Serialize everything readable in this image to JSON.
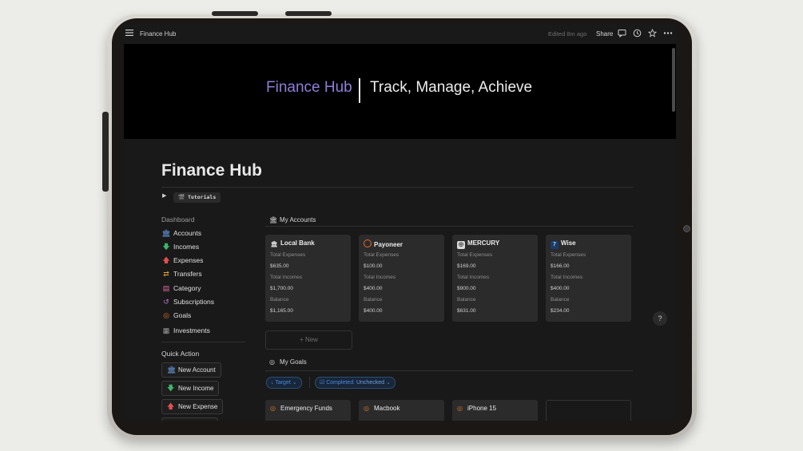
{
  "topbar": {
    "title": "Finance Hub",
    "edited": "Edited 8m ago",
    "share": "Share"
  },
  "cover": {
    "brand": "Finance Hub",
    "tagline": "Track, Manage, Achieve"
  },
  "page": {
    "title": "Finance Hub",
    "tutorials": "Tutorials"
  },
  "sidebar": {
    "dashboard_heading": "Dashboard",
    "items": [
      {
        "label": "Accounts",
        "icon": "bank-icon"
      },
      {
        "label": "Incomes",
        "icon": "arrow-down-icon"
      },
      {
        "label": "Expenses",
        "icon": "arrow-up-icon"
      },
      {
        "label": "Transfers",
        "icon": "transfer-icon"
      },
      {
        "label": "Category",
        "icon": "inbox-icon"
      },
      {
        "label": "Subscriptions",
        "icon": "refresh-icon"
      },
      {
        "label": "Goals",
        "icon": "target-icon"
      },
      {
        "label": "Investments",
        "icon": "chart-icon"
      }
    ],
    "quick_action_heading": "Quick Action",
    "quick_actions": [
      {
        "label": "New Account"
      },
      {
        "label": "New Income"
      },
      {
        "label": "New Expense"
      }
    ]
  },
  "accounts": {
    "heading": "My Accounts",
    "label_expenses": "Total Expenses",
    "label_incomes": "Total Incomes",
    "label_balance": "Balance",
    "cards": [
      {
        "name": "Local Bank",
        "expenses": "$635.00",
        "incomes": "$1,700.00",
        "balance": "$1,165.00"
      },
      {
        "name": "Payoneer",
        "expenses": "$100.00",
        "incomes": "$400.00",
        "balance": "$400.00"
      },
      {
        "name": "MERCURY",
        "expenses": "$169.00",
        "incomes": "$900.00",
        "balance": "$631.00"
      },
      {
        "name": "Wise",
        "expenses": "$166.00",
        "incomes": "$400.00",
        "balance": "$234.00"
      }
    ],
    "new_label": "New"
  },
  "goals": {
    "heading": "My Goals",
    "filter_target": "Target",
    "filter_completed": "Completed:",
    "filter_completed_value": "Unchecked",
    "cards": [
      {
        "name": "Emergency Funds"
      },
      {
        "name": "Macbook"
      },
      {
        "name": "iPhone 15"
      }
    ]
  },
  "help": "?",
  "colors": {
    "brand_purple": "#8f7ed8",
    "filter_blue": "#4c8ad8",
    "background": "#191919",
    "card": "#2b2b2b"
  }
}
